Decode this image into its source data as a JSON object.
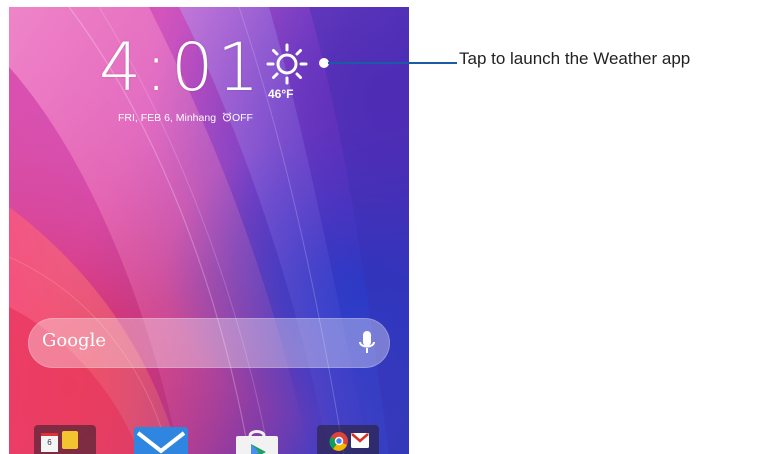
{
  "lockscreen": {
    "clock_time": "4:01",
    "weather": {
      "temperature": "46°F",
      "icon": "sun-icon"
    },
    "date_location": "FRI, FEB 6, Minhang",
    "alarm_status": "OFF"
  },
  "search": {
    "logo_text": "Google",
    "mic_icon": "microphone-icon"
  },
  "dock": {
    "calendar_day": "6"
  },
  "callout": {
    "text": "Tap to launch the Weather app"
  },
  "colors": {
    "callout_line": "#1a5aa6",
    "text": "#222222"
  }
}
